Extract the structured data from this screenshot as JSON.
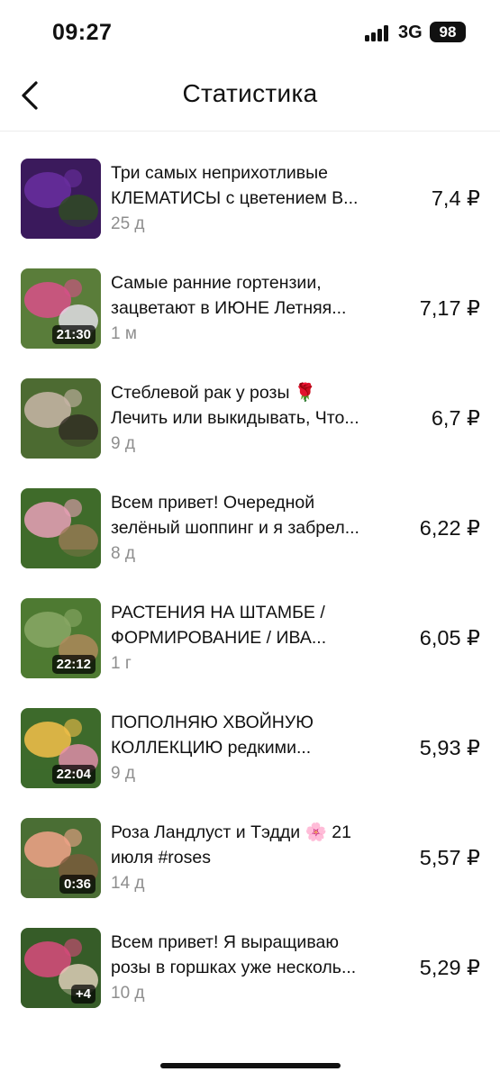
{
  "status_bar": {
    "time": "09:27",
    "network": "3G",
    "battery": "98"
  },
  "nav": {
    "back_icon": "chevron-left-icon",
    "title": "Статистика"
  },
  "videos": [
    {
      "title_line1": "Три самых неприхотливые",
      "title_line2": "КЛЕМАТИСЫ с цветением В...",
      "age": "25 д",
      "value": "7,4 ₽",
      "duration": "",
      "thumb_colors": [
        "#3b1a5c",
        "#6a2fa0",
        "#2e4d1f"
      ]
    },
    {
      "title_line1": "Самые ранние гортензии,",
      "title_line2": "зацветают в ИЮНЕ Летняя...",
      "age": "1 м",
      "value": "7,17 ₽",
      "duration": "21:30",
      "thumb_colors": [
        "#5a7d3a",
        "#d94f8a",
        "#e8e4f0"
      ]
    },
    {
      "title_line1": "Стеблевой рак у розы 🌹",
      "title_line2": "Лечить или выкидывать, Что...",
      "age": "9 д",
      "value": "6,7 ₽",
      "duration": "",
      "thumb_colors": [
        "#4d6b32",
        "#c9b6a8",
        "#2f2a22"
      ]
    },
    {
      "title_line1": "Всем привет! Очередной",
      "title_line2": "зелёный шоппинг и я забрел...",
      "age": "8 д",
      "value": "6,22 ₽",
      "duration": "",
      "thumb_colors": [
        "#3f6b2a",
        "#e9a0b8",
        "#9a7a55"
      ]
    },
    {
      "title_line1": "РАСТЕНИЯ НА ШТАМБЕ /",
      "title_line2": "ФОРМИРОВАНИЕ / ИВА...",
      "age": "1 г",
      "value": "6,05 ₽",
      "duration": "22:12",
      "thumb_colors": [
        "#4e7a32",
        "#8aa866",
        "#b38a5c"
      ]
    },
    {
      "title_line1": "ПОПОЛНЯЮ ХВОЙНУЮ",
      "title_line2": "КОЛЛЕКЦИЮ редкими...",
      "age": "9 д",
      "value": "5,93 ₽",
      "duration": "22:04",
      "thumb_colors": [
        "#3d6a2b",
        "#f4c04a",
        "#e78fb0"
      ]
    },
    {
      "title_line1": "Роза Ландлуст и Тэдди 🌸 21",
      "title_line2": "июля #roses",
      "age": "14 д",
      "value": "5,57 ₽",
      "duration": "0:36",
      "thumb_colors": [
        "#4a6e34",
        "#f2a38a",
        "#7c5a3c"
      ]
    },
    {
      "title_line1": "Всем привет! Я выращиваю",
      "title_line2": "розы в горшках уже несколь...",
      "age": "10 д",
      "value": "5,29 ₽",
      "duration": "+4",
      "thumb_colors": [
        "#365c28",
        "#d94a7c",
        "#e9d6c0"
      ]
    }
  ]
}
